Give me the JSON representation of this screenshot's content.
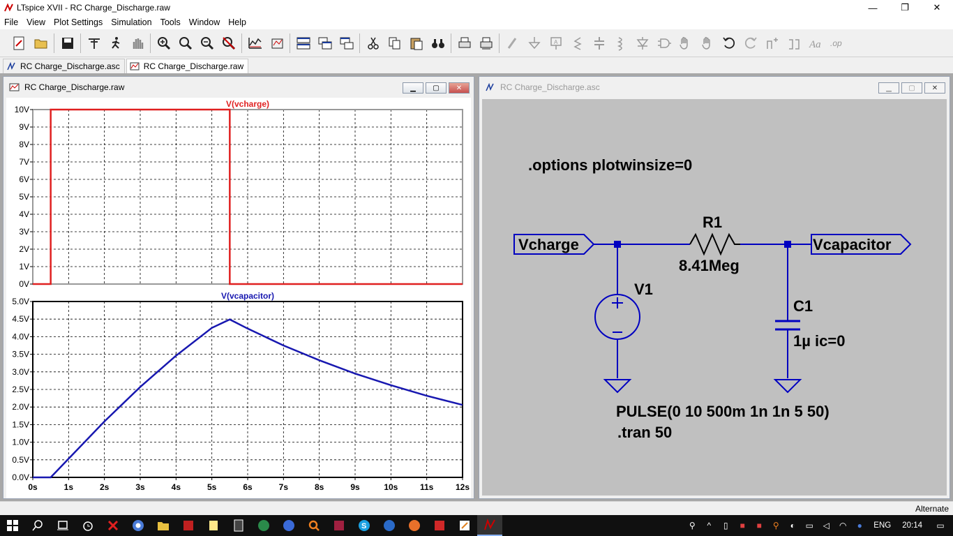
{
  "app": {
    "title": "LTspice XVII - RC Charge_Discharge.raw",
    "window_controls": [
      "—",
      "❐",
      "✕"
    ]
  },
  "menu": [
    "File",
    "View",
    "Plot Settings",
    "Simulation",
    "Tools",
    "Window",
    "Help"
  ],
  "toolbar_icons": [
    "new-schematic-icon",
    "open-icon",
    "save-icon",
    "control-panel-icon",
    "run-icon",
    "halt-icon",
    "zoom-in-icon",
    "zoom-full-icon",
    "zoom-out-icon",
    "zoom-cancel-icon",
    "autorange-icon",
    "plot-settings-icon",
    "tile-horizontal-icon",
    "cascade-icon",
    "tile-vertical-icon",
    "cut-icon",
    "copy-icon",
    "paste-icon",
    "find-icon",
    "print-icon",
    "print-setup-icon",
    "draw-wire-icon",
    "ground-icon",
    "label-net-icon",
    "resistor-icon",
    "capacitor-icon",
    "inductor-icon",
    "diode-icon",
    "component-icon",
    "move-icon",
    "drag-icon",
    "undo-icon",
    "redo-icon",
    "rotate-icon",
    "mirror-icon",
    "text-icon",
    "spice-directive-icon"
  ],
  "tabs": [
    {
      "label": "RC Charge_Discharge.asc",
      "active": false
    },
    {
      "label": "RC Charge_Discharge.raw",
      "active": true
    }
  ],
  "waveform_window": {
    "title": "RC Charge_Discharge.raw"
  },
  "schematic_window": {
    "title": "RC Charge_Discharge.asc"
  },
  "chart_data": [
    {
      "type": "line",
      "title": "V(vcharge)",
      "color": "#e02020",
      "x": [
        0,
        0.5,
        0.5,
        5.5,
        5.5,
        12
      ],
      "y": [
        0,
        0,
        10,
        10,
        0,
        0
      ],
      "xlim": [
        0,
        12
      ],
      "ylim": [
        0,
        10
      ],
      "yticks": [
        "0V",
        "1V",
        "2V",
        "3V",
        "4V",
        "5V",
        "6V",
        "7V",
        "8V",
        "9V",
        "10V"
      ],
      "grid": true
    },
    {
      "type": "line",
      "title": "V(vcapacitor)",
      "color": "#1818b0",
      "x": [
        0,
        0.5,
        1,
        2,
        3,
        4,
        5,
        5.5,
        6,
        7,
        8,
        9,
        10,
        11,
        12
      ],
      "y": [
        0,
        0,
        0.53,
        1.59,
        2.57,
        3.46,
        4.25,
        4.49,
        4.23,
        3.75,
        3.33,
        2.95,
        2.62,
        2.32,
        2.06
      ],
      "xlim": [
        0,
        12
      ],
      "ylim": [
        0,
        5
      ],
      "yticks": [
        "0.0V",
        "0.5V",
        "1.0V",
        "1.5V",
        "2.0V",
        "2.5V",
        "3.0V",
        "3.5V",
        "4.0V",
        "4.5V",
        "5.0V"
      ],
      "xticks": [
        "0s",
        "1s",
        "2s",
        "3s",
        "4s",
        "5s",
        "6s",
        "7s",
        "8s",
        "9s",
        "10s",
        "11s",
        "12s"
      ],
      "grid": true
    }
  ],
  "schematic": {
    "directive_options": ".options plotwinsize=0",
    "label_in": "Vcharge",
    "label_out": "Vcapacitor",
    "r_name": "R1",
    "r_value": "8.41Meg",
    "v_name": "V1",
    "c_name": "C1",
    "c_value": "1µ ic=0",
    "pulse": "PULSE(0 10 500m 1n 1n 5 50)",
    "tran": ".tran 50",
    "wire_color": "#0000c0"
  },
  "status": {
    "text": "Alternate"
  },
  "taskbar": {
    "apps": [
      "windows-start-icon",
      "search-icon",
      "task-view-icon",
      "alarm-icon",
      "close-red-icon",
      "chrome-icon",
      "file-explorer-icon",
      "app-red-icon",
      "notepad-icon",
      "calculator-icon",
      "app-green-icon",
      "app-blue-icon",
      "app-orange-icon",
      "app-dark-red-icon",
      "skype-icon",
      "edge-icon",
      "firefox-icon",
      "app-red2-icon",
      "app-notes-icon",
      "ltspice-icon"
    ],
    "language": "ENG",
    "time": "20:14"
  }
}
